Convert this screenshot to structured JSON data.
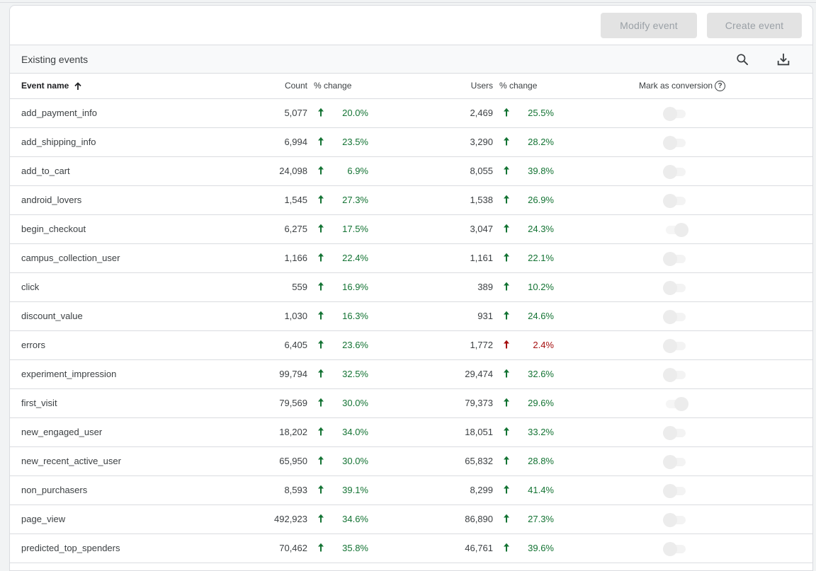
{
  "toolbar": {
    "modify_label": "Modify event",
    "create_label": "Create event"
  },
  "section": {
    "title": "Existing events",
    "search_icon": "search-icon",
    "download_icon": "download-icon"
  },
  "columns": {
    "event_name": "Event name",
    "count": "Count",
    "count_change": "% change",
    "users": "Users",
    "users_change": "% change",
    "mark_conversion": "Mark as conversion",
    "help_glyph": "?"
  },
  "colors": {
    "positive": "#137333",
    "negative": "#a50e0e"
  },
  "rows": [
    {
      "name": "add_payment_info",
      "count": "5,077",
      "count_change": "20.0%",
      "count_trend": "up-good",
      "users": "2,469",
      "users_change": "25.5%",
      "users_trend": "up-good",
      "conversion": false
    },
    {
      "name": "add_shipping_info",
      "count": "6,994",
      "count_change": "23.5%",
      "count_trend": "up-good",
      "users": "3,290",
      "users_change": "28.2%",
      "users_trend": "up-good",
      "conversion": false
    },
    {
      "name": "add_to_cart",
      "count": "24,098",
      "count_change": "6.9%",
      "count_trend": "up-good",
      "users": "8,055",
      "users_change": "39.8%",
      "users_trend": "up-good",
      "conversion": false
    },
    {
      "name": "android_lovers",
      "count": "1,545",
      "count_change": "27.3%",
      "count_trend": "up-good",
      "users": "1,538",
      "users_change": "26.9%",
      "users_trend": "up-good",
      "conversion": false
    },
    {
      "name": "begin_checkout",
      "count": "6,275",
      "count_change": "17.5%",
      "count_trend": "up-good",
      "users": "3,047",
      "users_change": "24.3%",
      "users_trend": "up-good",
      "conversion": true
    },
    {
      "name": "campus_collection_user",
      "count": "1,166",
      "count_change": "22.4%",
      "count_trend": "up-good",
      "users": "1,161",
      "users_change": "22.1%",
      "users_trend": "up-good",
      "conversion": false
    },
    {
      "name": "click",
      "count": "559",
      "count_change": "16.9%",
      "count_trend": "up-good",
      "users": "389",
      "users_change": "10.2%",
      "users_trend": "up-good",
      "conversion": false
    },
    {
      "name": "discount_value",
      "count": "1,030",
      "count_change": "16.3%",
      "count_trend": "up-good",
      "users": "931",
      "users_change": "24.6%",
      "users_trend": "up-good",
      "conversion": false
    },
    {
      "name": "errors",
      "count": "6,405",
      "count_change": "23.6%",
      "count_trend": "up-good",
      "users": "1,772",
      "users_change": "2.4%",
      "users_trend": "up-bad",
      "conversion": false
    },
    {
      "name": "experiment_impression",
      "count": "99,794",
      "count_change": "32.5%",
      "count_trend": "up-good",
      "users": "29,474",
      "users_change": "32.6%",
      "users_trend": "up-good",
      "conversion": false
    },
    {
      "name": "first_visit",
      "count": "79,569",
      "count_change": "30.0%",
      "count_trend": "up-good",
      "users": "79,373",
      "users_change": "29.6%",
      "users_trend": "up-good",
      "conversion": true
    },
    {
      "name": "new_engaged_user",
      "count": "18,202",
      "count_change": "34.0%",
      "count_trend": "up-good",
      "users": "18,051",
      "users_change": "33.2%",
      "users_trend": "up-good",
      "conversion": false
    },
    {
      "name": "new_recent_active_user",
      "count": "65,950",
      "count_change": "30.0%",
      "count_trend": "up-good",
      "users": "65,832",
      "users_change": "28.8%",
      "users_trend": "up-good",
      "conversion": false
    },
    {
      "name": "non_purchasers",
      "count": "8,593",
      "count_change": "39.1%",
      "count_trend": "up-good",
      "users": "8,299",
      "users_change": "41.4%",
      "users_trend": "up-good",
      "conversion": false
    },
    {
      "name": "page_view",
      "count": "492,923",
      "count_change": "34.6%",
      "count_trend": "up-good",
      "users": "86,890",
      "users_change": "27.3%",
      "users_trend": "up-good",
      "conversion": false
    },
    {
      "name": "predicted_top_spenders",
      "count": "70,462",
      "count_change": "35.8%",
      "count_trend": "up-good",
      "users": "46,761",
      "users_change": "39.6%",
      "users_trend": "up-good",
      "conversion": false
    }
  ]
}
